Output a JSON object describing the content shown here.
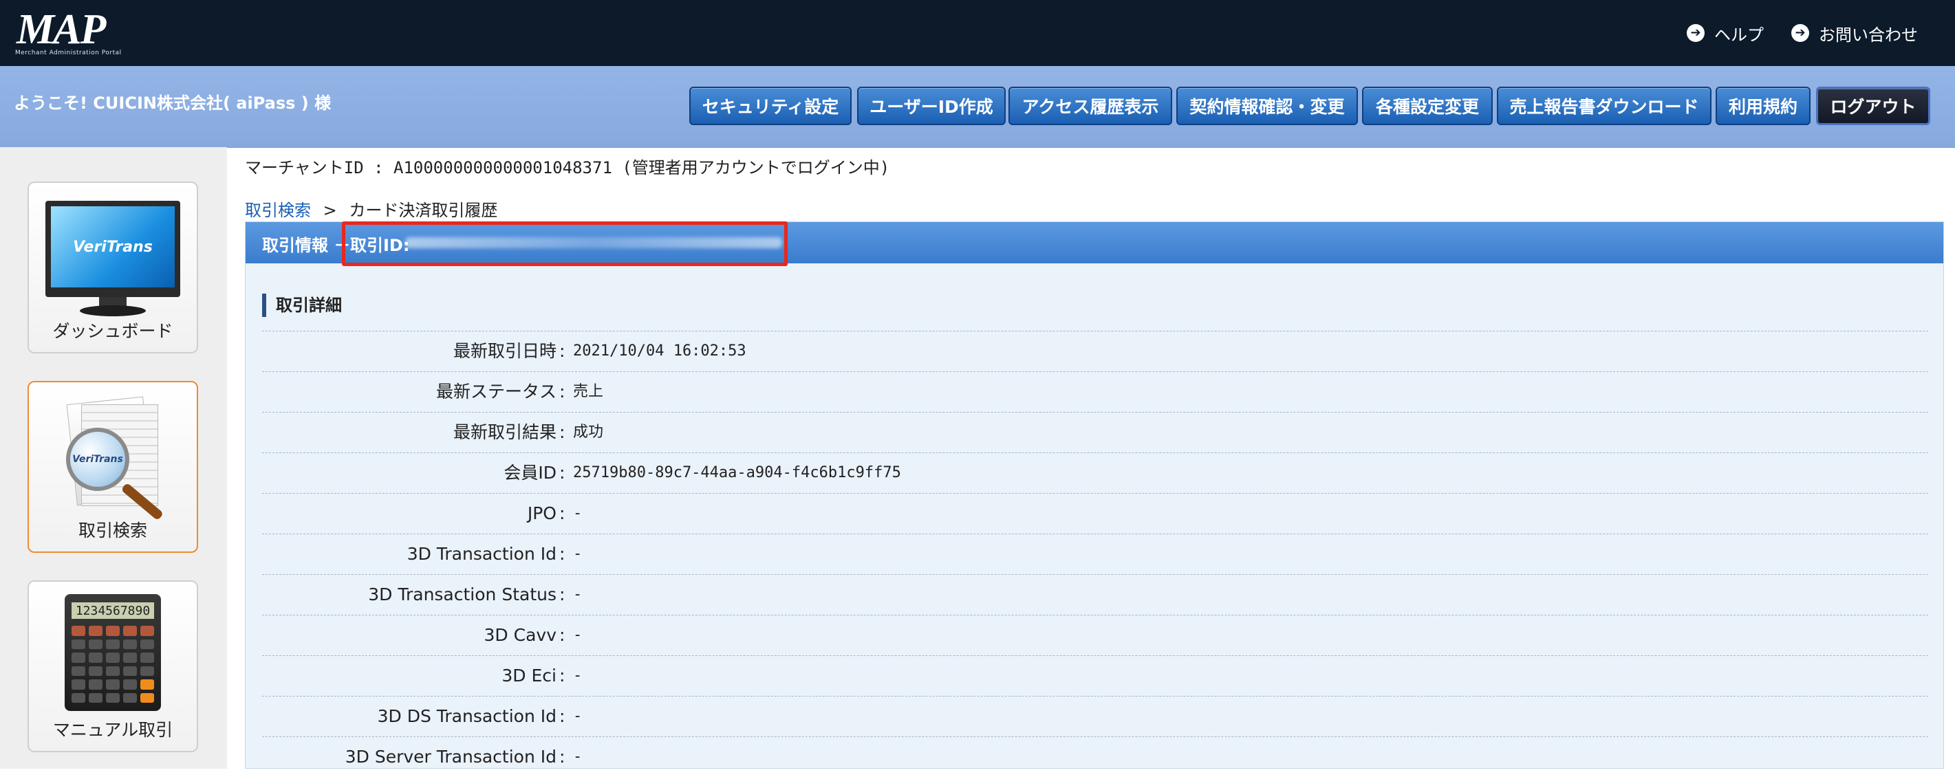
{
  "brand": {
    "logo_text": "MAP",
    "logo_subtitle": "Merchant Administration Portal"
  },
  "top_links": [
    {
      "label": "ヘルプ"
    },
    {
      "label": "お問い合わせ"
    }
  ],
  "header": {
    "welcome": "ようこそ! CUICIN株式会社( aiPass ) 様",
    "nav": [
      {
        "label": "セキュリティ設定"
      },
      {
        "label": "ユーザーID作成"
      },
      {
        "label": "アクセス履歴表示"
      },
      {
        "label": "契約情報確認・変更"
      },
      {
        "label": "各種設定変更"
      },
      {
        "label": "売上報告書ダウンロード"
      },
      {
        "label": "利用規約"
      },
      {
        "label": "ログアウト"
      }
    ]
  },
  "sidebar": {
    "items": [
      {
        "label": "ダッシュボード",
        "icon": "dashboard-monitor-icon",
        "screen_text": "VeriTrans"
      },
      {
        "label": "取引検索",
        "icon": "transaction-search-icon",
        "screen_text": "VeriTrans",
        "active": true
      },
      {
        "label": "マニュアル取引",
        "icon": "calculator-icon",
        "screen_text": "1234567890"
      }
    ]
  },
  "main": {
    "merchant_line": "マーチャントID : A100000000000001048371 (管理者用アカウントでログイン中)",
    "breadcrumb": {
      "link": "取引検索",
      "separator": ">",
      "current": "カード決済取引履歴"
    },
    "panel": {
      "title": "取引情報 －",
      "id_label": "取引ID:",
      "section_title": "取引詳細",
      "colon": ":",
      "rows": [
        {
          "label": "最新取引日時",
          "value": "2021/10/04 16:02:53"
        },
        {
          "label": "最新ステータス",
          "value": "売上"
        },
        {
          "label": "最新取引結果",
          "value": "成功"
        },
        {
          "label": "会員ID",
          "value": "25719b80-89c7-44aa-a904-f4c6b1c9ff75"
        },
        {
          "label": "JPO",
          "value": "-"
        },
        {
          "label": "3D Transaction Id",
          "value": "-"
        },
        {
          "label": "3D Transaction Status",
          "value": "-"
        },
        {
          "label": "3D Cavv",
          "value": "-"
        },
        {
          "label": "3D Eci",
          "value": "-"
        },
        {
          "label": "3D DS Transaction Id",
          "value": "-"
        },
        {
          "label": "3D Server Transaction Id",
          "value": "-"
        }
      ]
    }
  },
  "colors": {
    "topbar": "#0c1a2a",
    "header": "#8faee3",
    "nav_button": "#1a5fb3",
    "highlight": "#e8281c",
    "active_card_border": "#ef8b34"
  }
}
